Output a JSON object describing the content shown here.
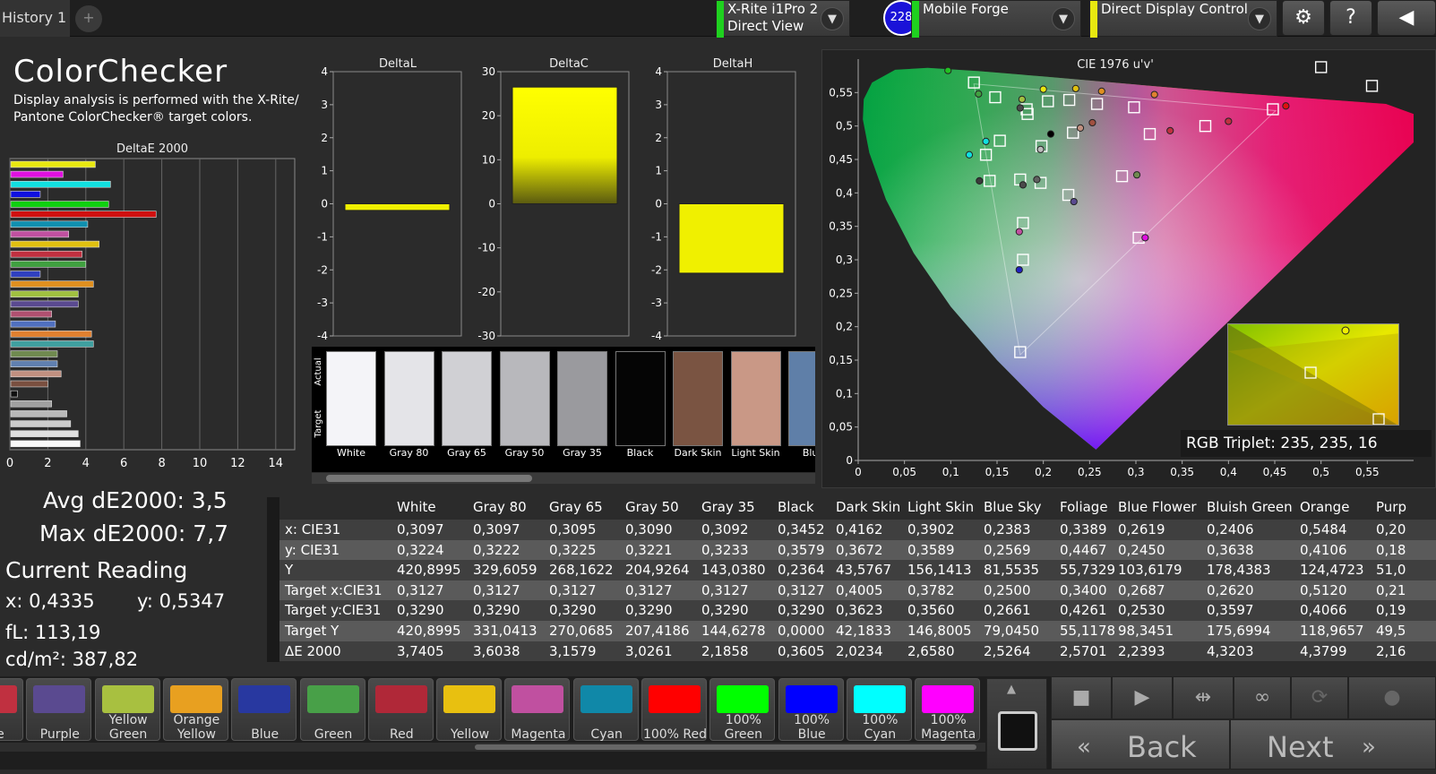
{
  "topbar": {
    "history_tab": "History 1",
    "add_tab": "+",
    "devices": [
      {
        "line1": "X-Rite i1Pro 2",
        "line2": "Direct View",
        "lamp": "#1fd11f"
      },
      {
        "line1": "Mobile Forge",
        "line2": "",
        "lamp": "#1fd11f"
      },
      {
        "line1": "Direct Display Control",
        "line2": "",
        "lamp": "#e8e810"
      }
    ],
    "badge": "228",
    "settings_icon": "⚙",
    "help_icon": "?"
  },
  "header": {
    "title": "ColorChecker",
    "subtitle": "Display analysis is performed with the X-Rite/ Pantone ColorChecker® target colors."
  },
  "chart_data": [
    {
      "type": "bar",
      "title": "DeltaE 2000",
      "orientation": "horizontal",
      "xlim": [
        0,
        15
      ],
      "xticks": [
        "0",
        "2",
        "4",
        "6",
        "8",
        "10",
        "12",
        "14"
      ],
      "bars": [
        {
          "value": 4.5,
          "color": "#e8e810"
        },
        {
          "value": 2.8,
          "color": "#e010e0"
        },
        {
          "value": 5.3,
          "color": "#10e0e0"
        },
        {
          "value": 1.6,
          "color": "#1010e0"
        },
        {
          "value": 5.2,
          "color": "#10d010"
        },
        {
          "value": 7.7,
          "color": "#d01010"
        },
        {
          "value": 4.1,
          "color": "#1090b0"
        },
        {
          "value": 3.1,
          "color": "#c050a0"
        },
        {
          "value": 4.7,
          "color": "#e0c010"
        },
        {
          "value": 3.8,
          "color": "#c03040"
        },
        {
          "value": 4.0,
          "color": "#40a040"
        },
        {
          "value": 1.6,
          "color": "#3040c0"
        },
        {
          "value": 4.4,
          "color": "#e09020"
        },
        {
          "value": 3.6,
          "color": "#a0c040"
        },
        {
          "value": 3.6,
          "color": "#5a4a90"
        },
        {
          "value": 2.2,
          "color": "#b05070"
        },
        {
          "value": 2.4,
          "color": "#5070c0"
        },
        {
          "value": 4.3,
          "color": "#e08030"
        },
        {
          "value": 4.4,
          "color": "#40a0a0"
        },
        {
          "value": 2.5,
          "color": "#708a50"
        },
        {
          "value": 2.5,
          "color": "#6080b0"
        },
        {
          "value": 2.7,
          "color": "#c09080"
        },
        {
          "value": 2.0,
          "color": "#7a5040"
        },
        {
          "value": 0.4,
          "color": "#111111"
        },
        {
          "value": 2.2,
          "color": "#a0a0a0"
        },
        {
          "value": 3.0,
          "color": "#b8b8b8"
        },
        {
          "value": 3.2,
          "color": "#cccccc"
        },
        {
          "value": 3.6,
          "color": "#e0e0e0"
        },
        {
          "value": 3.7,
          "color": "#f8f8f8"
        }
      ]
    },
    {
      "type": "bar",
      "title": "DeltaL",
      "ylim": [
        -4,
        4
      ],
      "yticks": [
        "4",
        "3",
        "2",
        "1",
        "0",
        "-1",
        "-2",
        "-3",
        "-4"
      ],
      "values": [
        -0.2
      ]
    },
    {
      "type": "bar",
      "title": "DeltaC",
      "ylim": [
        -30,
        30
      ],
      "yticks": [
        "30",
        "20",
        "10",
        "0",
        "-10",
        "-20",
        "-30"
      ],
      "values": [
        26.5
      ]
    },
    {
      "type": "bar",
      "title": "DeltaH",
      "ylim": [
        -4,
        4
      ],
      "yticks": [
        "4",
        "3",
        "2",
        "1",
        "0",
        "-1",
        "-2",
        "-3",
        "-4"
      ],
      "values": [
        -2.1
      ]
    },
    {
      "type": "scatter",
      "title": "CIE 1976 u'v'",
      "xlim": [
        0,
        0.6
      ],
      "ylim": [
        0,
        0.6
      ],
      "xticks": [
        "0",
        "0,05",
        "0,1",
        "0,15",
        "0,2",
        "0,25",
        "0,3",
        "0,35",
        "0,4",
        "0,45",
        "0,5",
        "0,55"
      ],
      "yticks": [
        "0",
        "0,05",
        "0,1",
        "0,15",
        "0,2",
        "0,25",
        "0,3",
        "0,35",
        "0,4",
        "0,45",
        "0,5",
        "0,55"
      ],
      "targets": [
        [
          0.125,
          0.565
        ],
        [
          0.148,
          0.543
        ],
        [
          0.182,
          0.525
        ],
        [
          0.205,
          0.537
        ],
        [
          0.228,
          0.539
        ],
        [
          0.258,
          0.533
        ],
        [
          0.298,
          0.528
        ],
        [
          0.375,
          0.5
        ],
        [
          0.448,
          0.525
        ],
        [
          0.183,
          0.518
        ],
        [
          0.153,
          0.478
        ],
        [
          0.138,
          0.457
        ],
        [
          0.198,
          0.47
        ],
        [
          0.232,
          0.49
        ],
        [
          0.315,
          0.488
        ],
        [
          0.142,
          0.418
        ],
        [
          0.175,
          0.42
        ],
        [
          0.197,
          0.415
        ],
        [
          0.227,
          0.397
        ],
        [
          0.285,
          0.425
        ],
        [
          0.178,
          0.355
        ],
        [
          0.178,
          0.3
        ],
        [
          0.175,
          0.162
        ],
        [
          0.303,
          0.333
        ],
        [
          0.5,
          0.588
        ],
        [
          0.555,
          0.56
        ]
      ],
      "measured": [
        [
          0.097,
          0.583,
          "#22c022"
        ],
        [
          0.13,
          0.548,
          "#40a040"
        ],
        [
          0.177,
          0.54,
          "#a0c040"
        ],
        [
          0.2,
          0.555,
          "#e8e810"
        ],
        [
          0.235,
          0.556,
          "#e0c010"
        ],
        [
          0.263,
          0.552,
          "#e09020"
        ],
        [
          0.32,
          0.547,
          "#e08030"
        ],
        [
          0.462,
          0.53,
          "#e01010"
        ],
        [
          0.175,
          0.527,
          "#4a4a4a"
        ],
        [
          0.138,
          0.477,
          "#10e0e0"
        ],
        [
          0.12,
          0.457,
          "#10e0e0"
        ],
        [
          0.208,
          0.488,
          "#000000"
        ],
        [
          0.24,
          0.497,
          "#c09080"
        ],
        [
          0.253,
          0.505,
          "#a05040"
        ],
        [
          0.337,
          0.493,
          "#c03040"
        ],
        [
          0.4,
          0.507,
          "#c03040"
        ],
        [
          0.131,
          0.418,
          "#3a3a3a"
        ],
        [
          0.178,
          0.412,
          "#4a4a4a"
        ],
        [
          0.193,
          0.42,
          "#606060"
        ],
        [
          0.233,
          0.387,
          "#5a4a90"
        ],
        [
          0.301,
          0.427,
          "#708a50"
        ],
        [
          0.174,
          0.342,
          "#c050a0"
        ],
        [
          0.174,
          0.285,
          "#2020c0"
        ],
        [
          0.197,
          0.465,
          "#bbbbbb"
        ],
        [
          0.31,
          0.333,
          "#e010e0"
        ]
      ]
    }
  ],
  "swatch_strip": {
    "label_actual": "Actual",
    "label_target": "Target",
    "items": [
      {
        "name": "White",
        "color": "#f4f4f8"
      },
      {
        "name": "Gray 80",
        "color": "#e4e4e8"
      },
      {
        "name": "Gray 65",
        "color": "#d0d0d4"
      },
      {
        "name": "Gray 50",
        "color": "#b8b8bc"
      },
      {
        "name": "Gray 35",
        "color": "#9a9a9e"
      },
      {
        "name": "Black",
        "color": "#050505"
      },
      {
        "name": "Dark Skin",
        "color": "#7a5442"
      },
      {
        "name": "Light Skin",
        "color": "#c99886"
      },
      {
        "name": "Blue",
        "color": "#5f7fa8"
      }
    ]
  },
  "cie": {
    "rgb_triplet": "RGB Triplet: 235, 235, 16"
  },
  "stats": {
    "avg": "Avg dE2000: 3,5",
    "max": "Max dE2000: 7,7",
    "current_reading": "Current Reading",
    "x": "x: 0,4335",
    "y": "y: 0,5347",
    "fl": "fL: 113,19",
    "cdm2": "cd/m²: 387,82"
  },
  "table": {
    "columns": [
      "White",
      "Gray 80",
      "Gray 65",
      "Gray 50",
      "Gray 35",
      "Black",
      "Dark Skin",
      "Light Skin",
      "Blue Sky",
      "Foliage",
      "Blue Flower",
      "Bluish Green",
      "Orange",
      "Purp"
    ],
    "rows": [
      {
        "label": "x: CIE31",
        "values": [
          "0,3097",
          "0,3097",
          "0,3095",
          "0,3090",
          "0,3092",
          "0,3452",
          "0,4162",
          "0,3902",
          "0,2383",
          "0,3389",
          "0,2619",
          "0,2406",
          "0,5484",
          "0,20"
        ]
      },
      {
        "label": "y: CIE31",
        "values": [
          "0,3224",
          "0,3222",
          "0,3225",
          "0,3221",
          "0,3233",
          "0,3579",
          "0,3672",
          "0,3589",
          "0,2569",
          "0,4467",
          "0,2450",
          "0,3638",
          "0,4106",
          "0,18"
        ]
      },
      {
        "label": "Y",
        "values": [
          "420,8995",
          "329,6059",
          "268,1622",
          "204,9264",
          "143,0380",
          "0,2364",
          "43,5767",
          "156,1413",
          "81,5535",
          "55,7329",
          "103,6179",
          "178,4383",
          "124,4723",
          "51,0"
        ]
      },
      {
        "label": "Target x:CIE31",
        "values": [
          "0,3127",
          "0,3127",
          "0,3127",
          "0,3127",
          "0,3127",
          "0,3127",
          "0,4005",
          "0,3782",
          "0,2500",
          "0,3400",
          "0,2687",
          "0,2620",
          "0,5120",
          "0,21"
        ]
      },
      {
        "label": "Target y:CIE31",
        "values": [
          "0,3290",
          "0,3290",
          "0,3290",
          "0,3290",
          "0,3290",
          "0,3290",
          "0,3623",
          "0,3560",
          "0,2661",
          "0,4261",
          "0,2530",
          "0,3597",
          "0,4066",
          "0,19"
        ]
      },
      {
        "label": "Target Y",
        "values": [
          "420,8995",
          "331,0413",
          "270,0685",
          "207,4186",
          "144,6278",
          "0,0000",
          "42,1833",
          "146,8005",
          "79,0450",
          "55,1178",
          "98,3451",
          "175,6994",
          "118,9657",
          "49,5"
        ]
      },
      {
        "label": "ΔE 2000",
        "values": [
          "3,7405",
          "3,6038",
          "3,1579",
          "3,0261",
          "2,1858",
          "0,3605",
          "2,0234",
          "2,6580",
          "2,5264",
          "2,5701",
          "2,2393",
          "4,3203",
          "4,3799",
          "2,16"
        ]
      }
    ]
  },
  "color_buttons": [
    {
      "l1": "rate",
      "l2": "",
      "color": "#c03040"
    },
    {
      "l1": "Purple",
      "l2": "",
      "color": "#5a4a90"
    },
    {
      "l1": "Yellow",
      "l2": "Green",
      "color": "#a8c040"
    },
    {
      "l1": "Orange",
      "l2": "Yellow",
      "color": "#e8a020"
    },
    {
      "l1": "Blue",
      "l2": "",
      "color": "#2838a0"
    },
    {
      "l1": "Green",
      "l2": "",
      "color": "#48a048"
    },
    {
      "l1": "Red",
      "l2": "",
      "color": "#b02838"
    },
    {
      "l1": "Yellow",
      "l2": "",
      "color": "#e8c010"
    },
    {
      "l1": "Magenta",
      "l2": "",
      "color": "#c050a0"
    },
    {
      "l1": "Cyan",
      "l2": "",
      "color": "#1088a8"
    },
    {
      "l1": "100% Red",
      "l2": "",
      "color": "#ff0000"
    },
    {
      "l1": "100%",
      "l2": "Green",
      "color": "#00ff00"
    },
    {
      "l1": "100%",
      "l2": "Blue",
      "color": "#0000ff"
    },
    {
      "l1": "100%",
      "l2": "Cyan",
      "color": "#00ffff"
    },
    {
      "l1": "100%",
      "l2": "Magenta",
      "color": "#ff00ff"
    }
  ],
  "controls": {
    "back": "Back",
    "next": "Next",
    "up_icon": "▲",
    "stop_icon": "■",
    "play_icon": "▶",
    "fit_icon": "⇹",
    "loop_icon": "∞",
    "refresh_icon": "⟳",
    "back_icon": "«",
    "next_icon": "»"
  }
}
